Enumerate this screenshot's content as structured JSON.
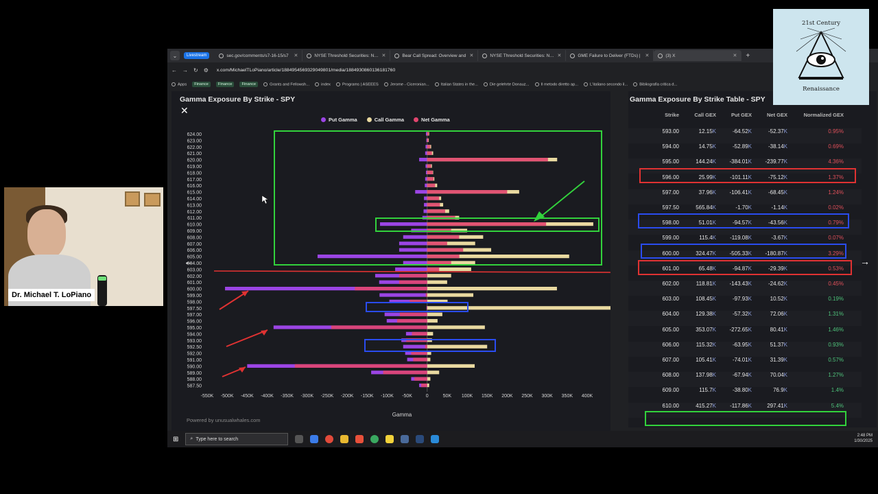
{
  "browser": {
    "live_badge": "Livestream",
    "tabs": [
      {
        "label": "sec.gov/comments/s7-16-15/s7"
      },
      {
        "label": "NYSE Threshold Securities: NYSE"
      },
      {
        "label": "Bear Call Spread: Overview and"
      },
      {
        "label": "NYSE Threshold Securities: NYSE"
      },
      {
        "label": "GME Failure to Deliver (FTDs) |"
      },
      {
        "label": "(3) X"
      }
    ],
    "url": "x.com/MichaelTLoPiano/article/1884954569329049801/media/1884930860136181760",
    "bookmarks": [
      "Apps",
      "Finance",
      "Finance",
      "Finance",
      "Grants and Fellowsh...",
      "index",
      "Programs | ASEEES",
      "Jerome - Ciceronian...",
      "Italian States in the...",
      "Die gelehrte Donauz...",
      "Il metodo diretto ap...",
      "L'italiano secondo il...",
      "Bibliografia critica d..."
    ]
  },
  "chart_panel": {
    "title": "Gamma Exposure By Strike - SPY",
    "legend": [
      "Put Gamma",
      "Call Gamma",
      "Net Gamma"
    ],
    "powered_by": "Powered by unusualwhales.com",
    "colors": {
      "put": "#9b45e4",
      "call": "#e9d9a0",
      "net": "#e0456e"
    }
  },
  "chart_data": {
    "type": "bar",
    "orientation": "horizontal",
    "title": "Gamma Exposure By Strike - SPY",
    "xlabel": "Gamma",
    "xlim": [
      -550000,
      400000
    ],
    "xticks": [
      "-550K",
      "-500K",
      "-450K",
      "-400K",
      "-350K",
      "-300K",
      "-250K",
      "-200K",
      "-150K",
      "-100K",
      "-50K",
      "0",
      "50K",
      "100K",
      "150K",
      "200K",
      "250K",
      "300K",
      "350K",
      "400K"
    ],
    "categories": [
      "624.00",
      "623.00",
      "622.00",
      "621.00",
      "620.00",
      "619.00",
      "618.00",
      "617.00",
      "616.00",
      "615.00",
      "614.00",
      "613.00",
      "612.00",
      "611.00",
      "610.00",
      "609.00",
      "608.00",
      "607.00",
      "606.00",
      "605.00",
      "604.00",
      "603.00",
      "602.00",
      "601.00",
      "600.00",
      "599.00",
      "598.00",
      "597.50",
      "597.00",
      "596.00",
      "595.00",
      "594.00",
      "593.00",
      "592.50",
      "592.00",
      "591.00",
      "590.00",
      "589.00",
      "588.00",
      "587.50"
    ],
    "series": [
      {
        "name": "Put Gamma",
        "values": [
          -3000,
          -2000,
          -4000,
          -5000,
          -20000,
          -4000,
          -3000,
          -5000,
          -6000,
          -30000,
          -8000,
          -8000,
          -9000,
          -12000,
          -117860,
          -40000,
          -60000,
          -70000,
          -70000,
          -274000,
          -60000,
          -80000,
          -130000,
          -120000,
          -505330,
          -119080,
          -94570,
          -1700,
          -106410,
          -101110,
          -384010,
          -52890,
          -64520,
          -60000,
          -55000,
          -50000,
          -450000,
          -140000,
          -40000,
          -20000
        ]
      },
      {
        "name": "Call Gamma",
        "values": [
          5000,
          4000,
          10000,
          15000,
          325000,
          12000,
          15000,
          18000,
          25000,
          230000,
          35000,
          40000,
          55000,
          80000,
          415270,
          100000,
          140000,
          120000,
          160000,
          355000,
          120000,
          110000,
          60000,
          50000,
          324470,
          115400,
          51010,
          565840,
          37960,
          25990,
          144240,
          14750,
          12150,
          150000,
          10000,
          8000,
          118810,
          30000,
          8000,
          5000
        ]
      },
      {
        "name": "Net Gamma",
        "values": [
          4000,
          3000,
          8000,
          12000,
          302000,
          10000,
          14000,
          16000,
          20000,
          200000,
          30000,
          32000,
          45000,
          70000,
          297410,
          60000,
          80000,
          50000,
          90000,
          80410,
          60000,
          30000,
          -70000,
          -70000,
          -180870,
          -3670,
          -43560,
          -1140,
          -68450,
          -75120,
          -239770,
          -38140,
          -52370,
          -5000,
          -40000,
          -35000,
          -331000,
          -110000,
          -32000,
          -15000
        ]
      }
    ]
  },
  "table_panel": {
    "title": "Gamma Exposure By Strike Table - SPY",
    "headers": [
      "Strike",
      "Call GEX",
      "Put GEX",
      "Net GEX",
      "Normalized GEX"
    ],
    "rows": [
      {
        "strike": "593.00",
        "call": "12.15",
        "put": "-64.52",
        "net": "-52.37",
        "norm": "0.95%"
      },
      {
        "strike": "594.00",
        "call": "14.75",
        "put": "-52.89",
        "net": "-38.14",
        "norm": "0.69%"
      },
      {
        "strike": "595.00",
        "call": "144.24",
        "put": "-384.01",
        "net": "-239.77",
        "norm": "4.36%"
      },
      {
        "strike": "596.00",
        "call": "25.99",
        "put": "-101.11",
        "net": "-75.12",
        "norm": "1.37%"
      },
      {
        "strike": "597.00",
        "call": "37.96",
        "put": "-106.41",
        "net": "-68.45",
        "norm": "1.24%"
      },
      {
        "strike": "597.50",
        "call": "565.84",
        "put": "-1.70",
        "net": "-1.14",
        "norm": "0.02%"
      },
      {
        "strike": "598.00",
        "call": "51.01",
        "put": "-94.57",
        "net": "-43.56",
        "norm": "0.79%"
      },
      {
        "strike": "599.00",
        "call": "115.4",
        "put": "-119.08",
        "net": "-3.67",
        "norm": "0.07%"
      },
      {
        "strike": "600.00",
        "call": "324.47",
        "put": "-505.33",
        "net": "-180.87",
        "norm": "3.29%"
      },
      {
        "strike": "601.00",
        "call": "65.48",
        "put": "-94.87",
        "net": "-29.39",
        "norm": "0.53%"
      },
      {
        "strike": "602.00",
        "call": "118.81",
        "put": "-143.43",
        "net": "-24.62",
        "norm": "0.45%"
      },
      {
        "strike": "603.00",
        "call": "108.45",
        "put": "-97.93",
        "net": "10.52",
        "norm": "0.19%"
      },
      {
        "strike": "604.00",
        "call": "129.38",
        "put": "-57.32",
        "net": "72.06",
        "norm": "1.31%"
      },
      {
        "strike": "605.00",
        "call": "353.07",
        "put": "-272.65",
        "net": "80.41",
        "norm": "1.46%"
      },
      {
        "strike": "606.00",
        "call": "115.32",
        "put": "-63.95",
        "net": "51.37",
        "norm": "0.93%"
      },
      {
        "strike": "607.00",
        "call": "105.41",
        "put": "-74.01",
        "net": "31.39",
        "norm": "0.57%"
      },
      {
        "strike": "608.00",
        "call": "137.98",
        "put": "-67.94",
        "net": "70.04",
        "norm": "1.27%"
      },
      {
        "strike": "609.00",
        "call": "115.7",
        "put": "-38.80",
        "net": "76.9",
        "norm": "1.4%"
      },
      {
        "strike": "610.00",
        "call": "415.27",
        "put": "-117.86",
        "net": "297.41",
        "norm": "5.4%"
      }
    ],
    "unit": "K"
  },
  "taskbar": {
    "search_placeholder": "Type here to search",
    "time": "2:48 PM",
    "date": "1/30/2025"
  },
  "webcam": {
    "name": "Dr. Michael T. LoPiano"
  },
  "logo": {
    "top_text": "21st Century",
    "bottom_text": "Renaissance"
  }
}
